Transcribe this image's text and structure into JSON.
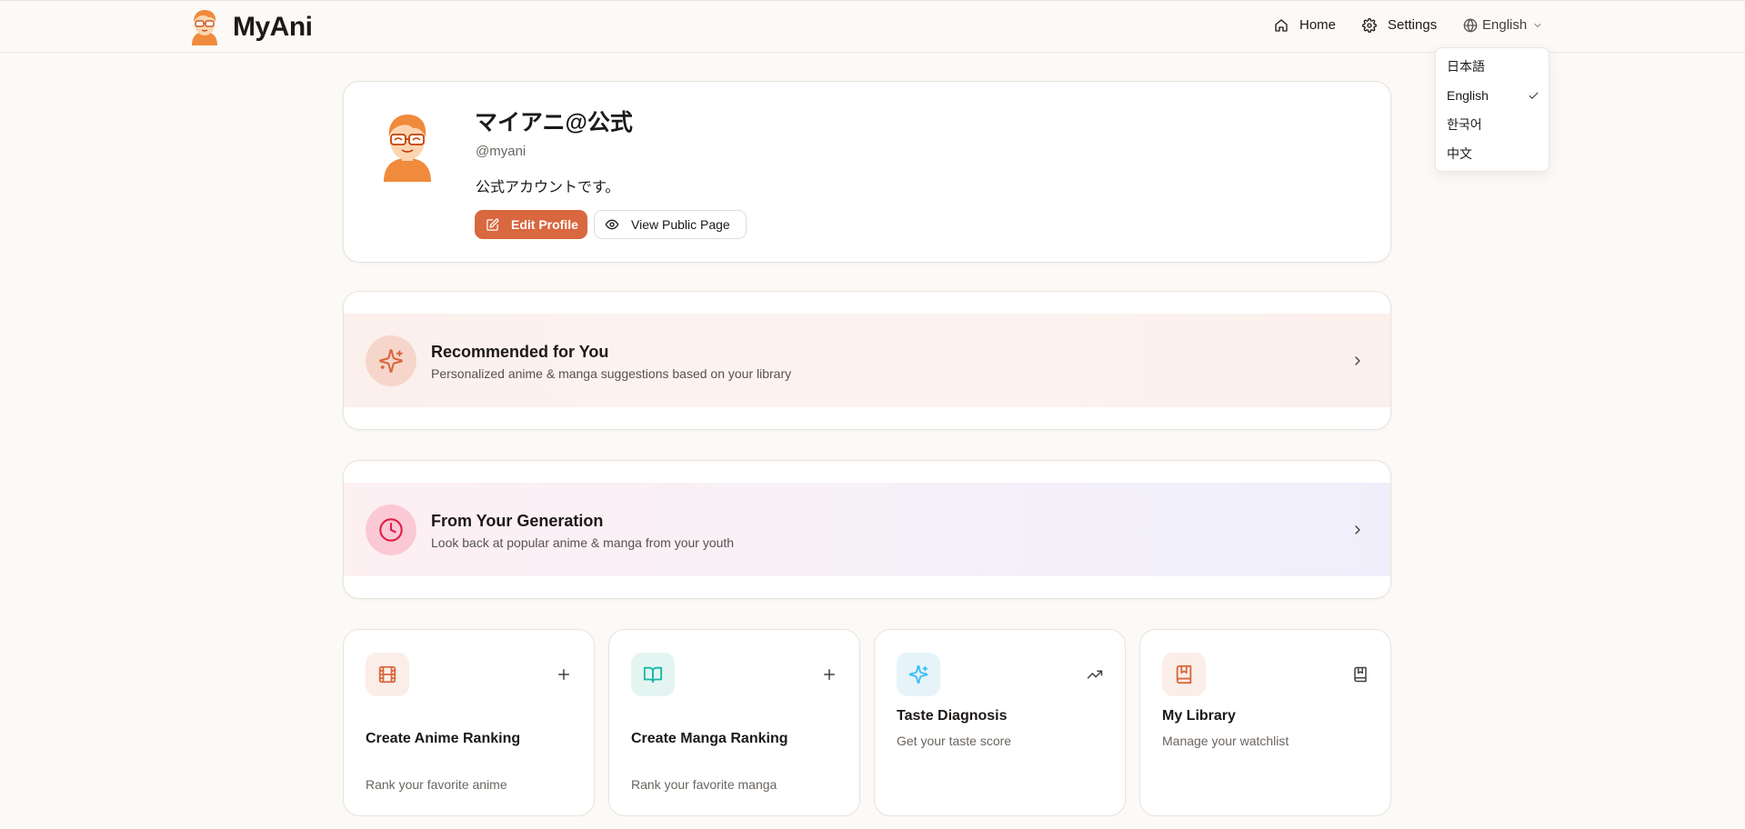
{
  "app": {
    "name": "MyAni"
  },
  "nav": {
    "home": "Home",
    "settings": "Settings",
    "language": "English"
  },
  "language_menu": {
    "items": [
      "日本語",
      "English",
      "한국어",
      "中文"
    ],
    "selected": "English"
  },
  "profile": {
    "name": "マイアニ@公式",
    "handle": "@myani",
    "bio": "公式アカウントです。",
    "edit_button": "Edit Profile",
    "view_button": "View Public Page"
  },
  "features": {
    "recommended": {
      "title": "Recommended for You",
      "subtitle": "Personalized anime & manga suggestions based on your library"
    },
    "generation": {
      "title": "From Your Generation",
      "subtitle": "Look back at popular anime & manga from your youth"
    }
  },
  "tiles": [
    {
      "title": "Create Anime Ranking",
      "subtitle": "Rank your favorite anime",
      "icon": "film-icon",
      "action_icon": "plus-icon"
    },
    {
      "title": "Create Manga Ranking",
      "subtitle": "Rank your favorite manga",
      "icon": "book-open-icon",
      "action_icon": "plus-icon"
    },
    {
      "title": "Taste Diagnosis",
      "subtitle": "Get your taste score",
      "icon": "sparkles-icon",
      "action_icon": "trending-up-icon"
    },
    {
      "title": "My Library",
      "subtitle": "Manage your watchlist",
      "icon": "bookmark-book-icon",
      "action_icon": "bookmark-book-icon"
    }
  ],
  "colors": {
    "accent": "#d9673f",
    "brand_orange": "#f08a3c",
    "generation_pink": "#e11d48",
    "teal": "#14b8a6",
    "sky": "#38bdf8"
  }
}
